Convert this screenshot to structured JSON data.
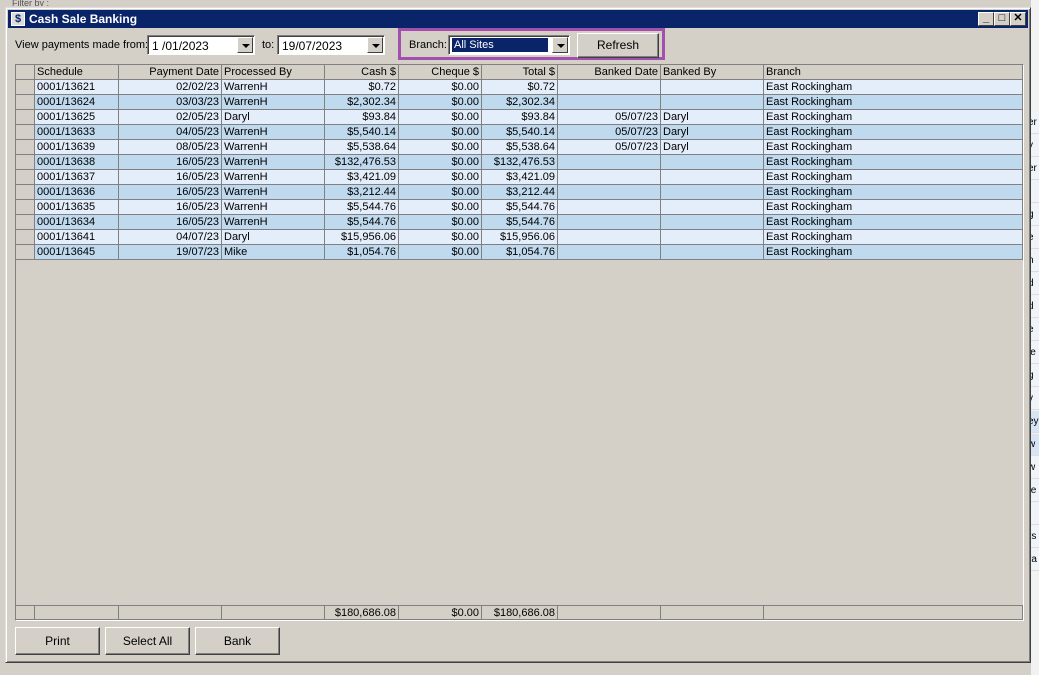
{
  "window": {
    "title": "Cash Sale Banking"
  },
  "filters": {
    "view_label": "View payments made from:",
    "from_date": "1 /01/2023",
    "to_label": "to:",
    "to_date": "19/07/2023",
    "branch_label": "Branch:",
    "branch_value": "All Sites",
    "refresh_label": "Refresh"
  },
  "grid": {
    "columns": [
      "Schedule",
      "Payment Date",
      "Processed By",
      "Cash $",
      "Cheque $",
      "Total $",
      "Banked Date",
      "Banked By",
      "Branch"
    ],
    "rows": [
      [
        "0001/13621",
        "02/02/23",
        "WarrenH",
        "$0.72",
        "$0.00",
        "$0.72",
        "",
        "",
        "East Rockingham"
      ],
      [
        "0001/13624",
        "03/03/23",
        "WarrenH",
        "$2,302.34",
        "$0.00",
        "$2,302.34",
        "",
        "",
        "East Rockingham"
      ],
      [
        "0001/13625",
        "02/05/23",
        "Daryl",
        "$93.84",
        "$0.00",
        "$93.84",
        "05/07/23",
        "Daryl",
        "East Rockingham"
      ],
      [
        "0001/13633",
        "04/05/23",
        "WarrenH",
        "$5,540.14",
        "$0.00",
        "$5,540.14",
        "05/07/23",
        "Daryl",
        "East Rockingham"
      ],
      [
        "0001/13639",
        "08/05/23",
        "WarrenH",
        "$5,538.64",
        "$0.00",
        "$5,538.64",
        "05/07/23",
        "Daryl",
        "East Rockingham"
      ],
      [
        "0001/13638",
        "16/05/23",
        "WarrenH",
        "$132,476.53",
        "$0.00",
        "$132,476.53",
        "",
        "",
        "East Rockingham"
      ],
      [
        "0001/13637",
        "16/05/23",
        "WarrenH",
        "$3,421.09",
        "$0.00",
        "$3,421.09",
        "",
        "",
        "East Rockingham"
      ],
      [
        "0001/13636",
        "16/05/23",
        "WarrenH",
        "$3,212.44",
        "$0.00",
        "$3,212.44",
        "",
        "",
        "East Rockingham"
      ],
      [
        "0001/13635",
        "16/05/23",
        "WarrenH",
        "$5,544.76",
        "$0.00",
        "$5,544.76",
        "",
        "",
        "East Rockingham"
      ],
      [
        "0001/13634",
        "16/05/23",
        "WarrenH",
        "$5,544.76",
        "$0.00",
        "$5,544.76",
        "",
        "",
        "East Rockingham"
      ],
      [
        "0001/13641",
        "04/07/23",
        "Daryl",
        "$15,956.06",
        "$0.00",
        "$15,956.06",
        "",
        "",
        "East Rockingham"
      ],
      [
        "0001/13645",
        "19/07/23",
        "Mike",
        "$1,054.76",
        "$0.00",
        "$1,054.76",
        "",
        "",
        "East Rockingham"
      ]
    ],
    "totals": [
      "",
      "",
      "",
      "$180,686.08",
      "$0.00",
      "$180,686.08",
      "",
      "",
      ""
    ]
  },
  "buttons": {
    "print": "Print",
    "select_all": "Select All",
    "bank": "Bank"
  },
  "background": {
    "filter_text": "Filter by :",
    "row_fragments": [
      "er",
      "y",
      "er",
      "i",
      "g",
      "e",
      "n",
      "d",
      "d",
      "e",
      "le",
      "g",
      "v",
      "ey",
      "w",
      "w",
      "te",
      "",
      "rs",
      "ra"
    ]
  },
  "colors": {
    "title_bar": "#0a246a",
    "row_light": "#e3eefa",
    "row_dark": "#bfd9ee",
    "highlight_border": "#a24fb0"
  },
  "icons": {
    "window": "app-window-icon",
    "minimize": "minimize-icon",
    "maximize": "maximize-icon",
    "close": "close-icon",
    "dropdown": "chevron-down-icon"
  }
}
